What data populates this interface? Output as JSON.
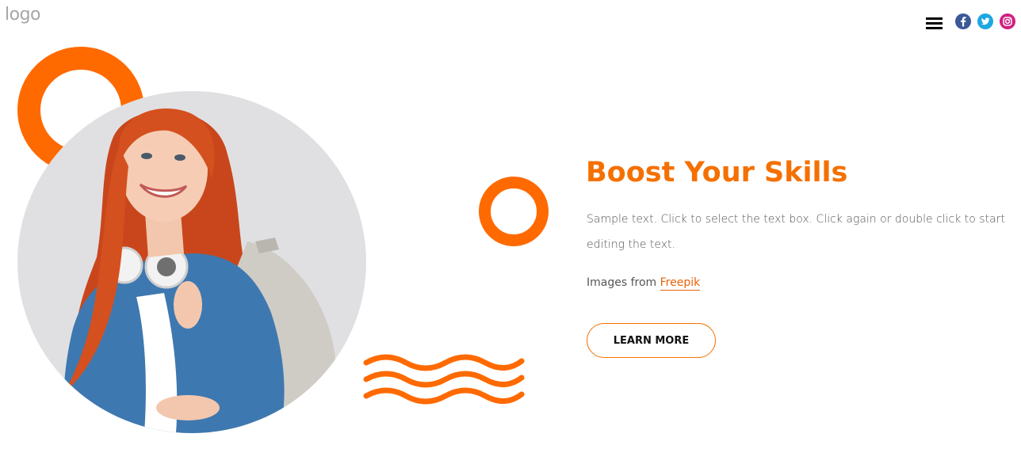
{
  "header": {
    "logo_text": "logo",
    "menu_icon": "hamburger-menu-icon",
    "social": [
      {
        "name": "facebook-icon",
        "color": "#3b5998"
      },
      {
        "name": "twitter-icon",
        "color": "#1ea7e1"
      },
      {
        "name": "instagram-icon",
        "color": "#d21e7e"
      }
    ]
  },
  "hero": {
    "title": "Boost Your Skills",
    "body": "Sample text. Click to select the text box. Click again or double click to start editing the text.",
    "credit_prefix": "Images from ",
    "credit_link": "Freepik",
    "button_label": "LEARN MORE"
  },
  "colors": {
    "accent": "#ff6a00",
    "title": "#f57000",
    "photo_background": "#e0e0e2"
  }
}
